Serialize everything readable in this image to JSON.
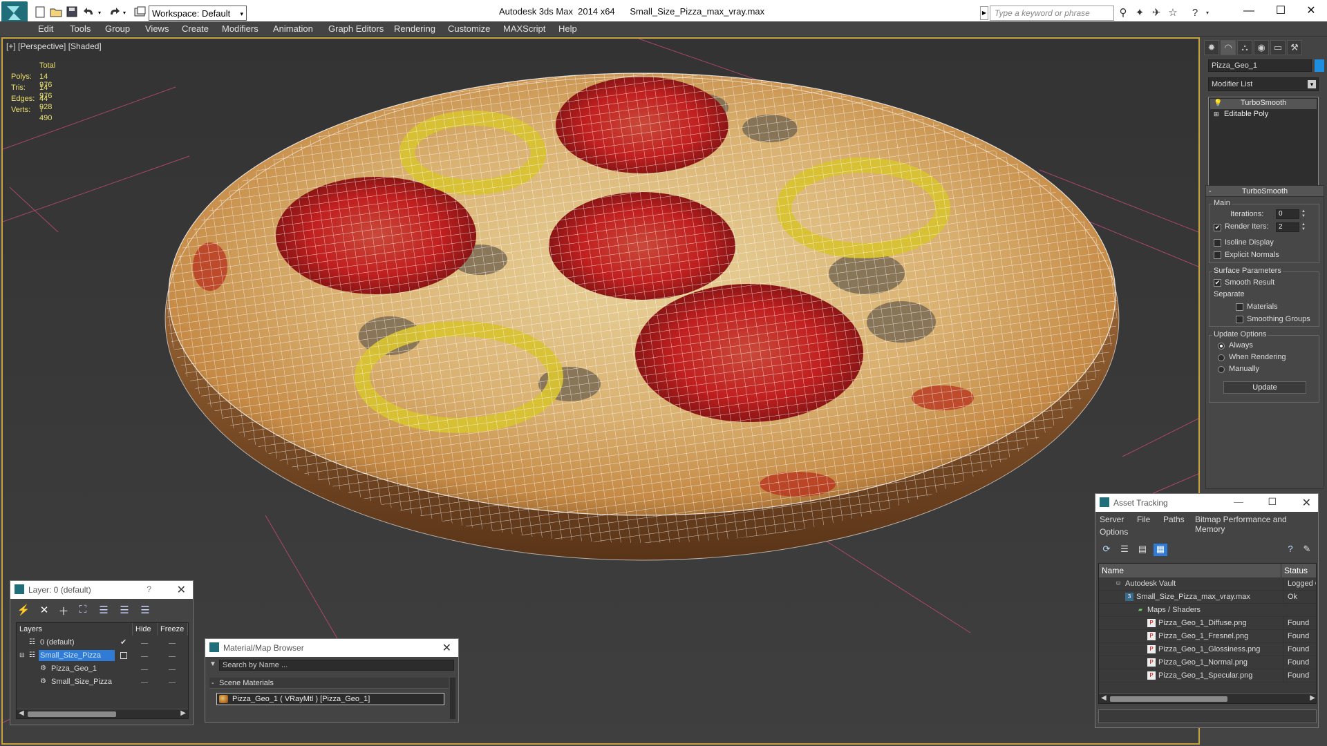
{
  "app": {
    "title": "Autodesk 3ds Max  2014 x64      Small_Size_Pizza_max_vray.max",
    "workspace": "Workspace: Default",
    "search_placeholder": "Type a keyword or phrase"
  },
  "menu": [
    "Edit",
    "Tools",
    "Group",
    "Views",
    "Create",
    "Modifiers",
    "Animation",
    "Graph Editors",
    "Rendering",
    "Customize",
    "MAXScript",
    "Help"
  ],
  "viewport": {
    "label": "[+] [Perspective] [Shaded]",
    "stats": {
      "total_label": "Total",
      "rows": [
        {
          "key": "Polys:",
          "value": "14 976"
        },
        {
          "key": "Tris:",
          "value": "14 976"
        },
        {
          "key": "Edges:",
          "value": "44 928"
        },
        {
          "key": "Verts:",
          "value": "7 490"
        }
      ]
    }
  },
  "command_panel": {
    "object_name": "Pizza_Geo_1",
    "object_color": "#1e8ee0",
    "modifier_list": "Modifier List",
    "stack": [
      "TurboSmooth",
      "Editable Poly"
    ],
    "turbosmooth": {
      "title": "TurboSmooth",
      "main_group": "Main",
      "iterations_label": "Iterations:",
      "iterations_value": "0",
      "render_iters_label": "Render Iters:",
      "render_iters_value": "2",
      "isoline_label": "Isoline Display",
      "explicit_normals_label": "Explicit Normals",
      "surface_group": "Surface Parameters",
      "smooth_result_label": "Smooth Result",
      "separate_label": "Separate",
      "materials_label": "Materials",
      "smoothing_groups_label": "Smoothing Groups",
      "update_group": "Update Options",
      "always_label": "Always",
      "when_rendering_label": "When Rendering",
      "manually_label": "Manually",
      "update_button": "Update"
    }
  },
  "layer_window": {
    "title": "Layer: 0 (default)",
    "help": "?",
    "columns": [
      "Layers",
      "Hide",
      "Freeze"
    ],
    "rows": [
      {
        "name": "0 (default)",
        "indent": 1
      },
      {
        "name": "Small_Size_Pizza",
        "indent": 1,
        "selected": true
      },
      {
        "name": "Pizza_Geo_1",
        "indent": 2
      },
      {
        "name": "Small_Size_Pizza",
        "indent": 2
      }
    ]
  },
  "material_browser": {
    "title": "Material/Map Browser",
    "search_placeholder": "Search by Name ...",
    "section": "Scene Materials",
    "item": "Pizza_Geo_1  ( VRayMtl )  [Pizza_Geo_1]"
  },
  "asset_tracking": {
    "title": "Asset Tracking",
    "menu": [
      "Server",
      "File",
      "Paths",
      "Bitmap Performance and Memory",
      "Options"
    ],
    "columns": [
      "Name",
      "Status"
    ],
    "rows": [
      {
        "name": "Autodesk Vault",
        "status": "Logged O",
        "indent": 1,
        "icon": "vault"
      },
      {
        "name": "Small_Size_Pizza_max_vray.max",
        "status": "Ok",
        "indent": 2,
        "icon": "max"
      },
      {
        "name": "Maps / Shaders",
        "status": "",
        "indent": 3,
        "icon": "folder"
      },
      {
        "name": "Pizza_Geo_1_Diffuse.png",
        "status": "Found",
        "indent": 4,
        "icon": "png"
      },
      {
        "name": "Pizza_Geo_1_Fresnel.png",
        "status": "Found",
        "indent": 4,
        "icon": "png"
      },
      {
        "name": "Pizza_Geo_1_Glossiness.png",
        "status": "Found",
        "indent": 4,
        "icon": "png"
      },
      {
        "name": "Pizza_Geo_1_Normal.png",
        "status": "Found",
        "indent": 4,
        "icon": "png"
      },
      {
        "name": "Pizza_Geo_1_Specular.png",
        "status": "Found",
        "indent": 4,
        "icon": "png"
      }
    ]
  },
  "colors": {
    "viewport_border": "#c8a23a",
    "stats_text": "#ece072",
    "selection": "#2f7bd6"
  }
}
